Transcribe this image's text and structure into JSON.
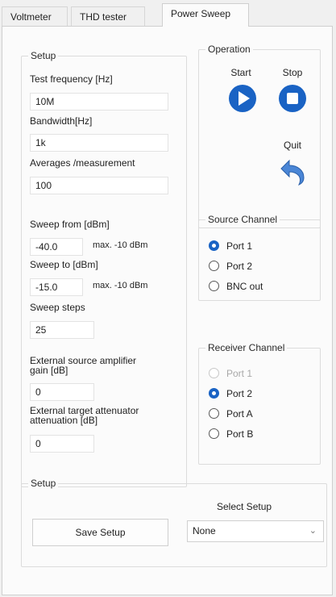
{
  "tabs": [
    {
      "label": "Voltmeter"
    },
    {
      "label": "THD tester"
    },
    {
      "label": "Power Sweep"
    }
  ],
  "setup": {
    "title": "Setup",
    "test_frequency_label": "Test frequency [Hz]",
    "test_frequency_value": "10M",
    "bandwidth_label": "Bandwidth[Hz]",
    "bandwidth_value": "1k",
    "averages_label": "Averages /measurement",
    "averages_value": "100",
    "sweep_from_label": "Sweep from [dBm]",
    "sweep_from_value": "-40.0",
    "sweep_from_max": "max. -10 dBm",
    "sweep_to_label": "Sweep to [dBm]",
    "sweep_to_value": "-15.0",
    "sweep_to_max": "max. -10 dBm",
    "sweep_steps_label": "Sweep steps",
    "sweep_steps_value": "25",
    "ext_amp_label_1": "External source amplifier",
    "ext_amp_label_2": "gain [dB]",
    "ext_amp_value": "0",
    "ext_att_label_1": "External target attenuator",
    "ext_att_label_2": "attenuation [dB]",
    "ext_att_value": "0"
  },
  "operation": {
    "title": "Operation",
    "start_label": "Start",
    "stop_label": "Stop",
    "quit_label": "Quit",
    "accent": "#1a63c4",
    "quit_color": "#4a86d6"
  },
  "source_channel": {
    "title": "Source Channel",
    "options": [
      "Port 1",
      "Port 2",
      "BNC out"
    ],
    "selected": "Port 1"
  },
  "receiver_channel": {
    "title": "Receiver Channel",
    "options": [
      "Port 1",
      "Port 2",
      "Port A",
      "Port B"
    ],
    "selected": "Port 2",
    "disabled": "Port 1"
  },
  "bottom_setup": {
    "title": "Setup",
    "save_label": "Save Setup",
    "select_label": "Select Setup",
    "select_value": "None"
  }
}
